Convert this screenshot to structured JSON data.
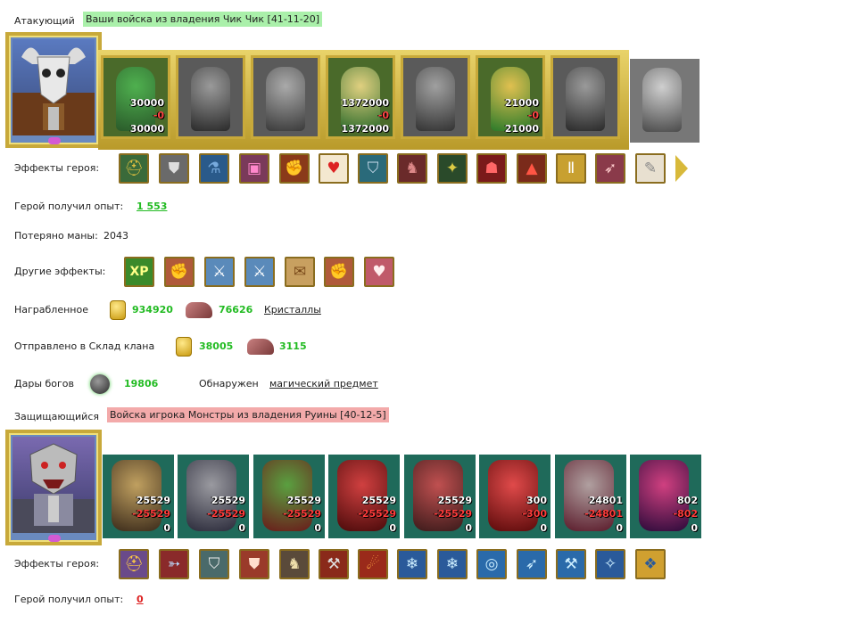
{
  "attacker": {
    "label": "Атакующий",
    "title": "Ваши войска из владения Чик Чик [41-11-20]",
    "portrait_icon": "bull-skull-hero-portrait",
    "troops": [
      {
        "icon": "dwarf-warrior",
        "count": "30000",
        "loss": "-0",
        "remain": "30000",
        "active": true
      },
      {
        "icon": "dark-knight",
        "count": "",
        "loss": "",
        "remain": "",
        "active": false
      },
      {
        "icon": "spearman",
        "count": "",
        "loss": "",
        "remain": "",
        "active": false
      },
      {
        "icon": "griffin-rider",
        "count": "1372000",
        "loss": "-0",
        "remain": "1372000",
        "active": true
      },
      {
        "icon": "archer",
        "count": "",
        "loss": "",
        "remain": "",
        "active": false
      },
      {
        "icon": "druid-mage",
        "count": "21000",
        "loss": "-0",
        "remain": "21000",
        "active": true
      },
      {
        "icon": "hooded-knight",
        "count": "",
        "loss": "",
        "remain": "",
        "active": false
      },
      {
        "icon": "wizard-statue",
        "count": "",
        "loss": "",
        "remain": "",
        "active": false
      }
    ],
    "effects_label": "Эффекты героя:",
    "effects": [
      "helmet-icon",
      "armor-icon",
      "potion-icon",
      "chest-icon",
      "fire-gauntlet-icon",
      "heart-icon",
      "shield-icon",
      "cloak-icon",
      "amulet-icon",
      "mask-icon",
      "boots-icon",
      "greaves-icon",
      "bow-icon",
      "scroll-icon"
    ],
    "exp_label": "Герой получил опыт:",
    "exp_value": "1 553",
    "mana_label": "Потеряно маны:",
    "mana_value": "2043",
    "other_label": "Другие эффекты:",
    "other_effects": [
      "xp-icon",
      "fist-sword-icon",
      "sword-icon",
      "sword-icon",
      "scroll-bundle-icon",
      "fist-sword-icon",
      "heart-sword-icon"
    ],
    "other_xp_text": "XP",
    "loot_label": "Награбленное",
    "loot_gold": "934920",
    "loot_ore": "76626",
    "loot_link": "Кристаллы",
    "clan_label": "Отправлено в Склад клана",
    "clan_gold": "38005",
    "clan_ore": "3115",
    "gifts_label": "Дары богов",
    "gifts_value": "19806",
    "found_label": "Обнаружен",
    "found_link": "магический предмет"
  },
  "defender": {
    "label": "Защищающийся",
    "title": "Войска игрока Монстры из владения Руины [40-12-5]",
    "portrait_icon": "beast-warrior-hero-portrait",
    "troops": [
      {
        "icon": "lizard-brute",
        "count": "25529",
        "loss": "-25529",
        "remain": "0"
      },
      {
        "icon": "stone-golem",
        "count": "25529",
        "loss": "-25529",
        "remain": "0"
      },
      {
        "icon": "orc-warlord",
        "count": "25529",
        "loss": "-25529",
        "remain": "0"
      },
      {
        "icon": "winged-demon",
        "count": "25529",
        "loss": "-25529",
        "remain": "0"
      },
      {
        "icon": "spider-beast",
        "count": "25529",
        "loss": "-25529",
        "remain": "0"
      },
      {
        "icon": "red-fiend",
        "count": "300",
        "loss": "-300",
        "remain": "0"
      },
      {
        "icon": "stone-tower-golem",
        "count": "24801",
        "loss": "-24801",
        "remain": "0"
      },
      {
        "icon": "tentacle-demon",
        "count": "802",
        "loss": "-802",
        "remain": "0"
      }
    ],
    "effects_label": "Эффекты героя:",
    "effects": [
      "helmet-icon",
      "crossbow-icon",
      "shield-icon",
      "armor-icon",
      "cloak-icon",
      "crossed-axes-icon",
      "fire-head-icon",
      "crystal-armor-icon",
      "crystal-armor-icon",
      "crystal-ring-icon",
      "crystal-bow-icon",
      "crystal-hammer-icon",
      "crystal-shard-icon",
      "crystal-cloak-icon"
    ],
    "exp_label": "Герой получил опыт:",
    "exp_value": "0"
  },
  "colors": {
    "green_highlight": "#aaf0aa",
    "red_highlight": "#f3aaaa",
    "gain_green": "#22bb22",
    "loss_red": "#dd2222",
    "frame_gold": "#c8a93a"
  }
}
